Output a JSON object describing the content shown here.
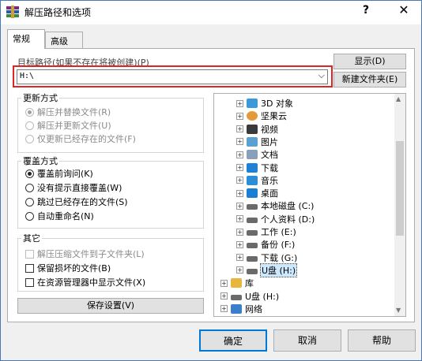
{
  "window": {
    "title": "解压路径和选项",
    "help": "?",
    "close": "✕"
  },
  "tabs": [
    {
      "label": "常规"
    },
    {
      "label": "高级"
    }
  ],
  "destination": {
    "label": "目标路径(如果不存在将被创建)(P)",
    "value": "H:\\",
    "show_button": "显示(D)",
    "new_folder_button": "新建文件夹(E)"
  },
  "update_mode": {
    "title": "更新方式",
    "options": [
      {
        "label": "解压并替换文件(R)",
        "checked": true,
        "disabled": true
      },
      {
        "label": "解压并更新文件(U)",
        "checked": false,
        "disabled": true
      },
      {
        "label": "仅更新已经存在的文件(F)",
        "checked": false,
        "disabled": true
      }
    ]
  },
  "overwrite_mode": {
    "title": "覆盖方式",
    "options": [
      {
        "label": "覆盖前询问(K)",
        "checked": true
      },
      {
        "label": "没有提示直接覆盖(W)",
        "checked": false
      },
      {
        "label": "跳过已经存在的文件(S)",
        "checked": false
      },
      {
        "label": "自动重命名(N)",
        "checked": false
      }
    ]
  },
  "misc": {
    "title": "其它",
    "options": [
      {
        "label": "解压压缩文件到子文件夹(L)",
        "checked": false,
        "disabled": true
      },
      {
        "label": "保留损坏的文件(B)",
        "checked": false,
        "disabled": false
      },
      {
        "label": "在资源管理器中显示文件(X)",
        "checked": false,
        "disabled": false
      }
    ]
  },
  "save_button": "保存设置(V)",
  "tree": [
    {
      "label": "3D 对象",
      "icon": "3d-objects-icon",
      "color": "#3a9ad9"
    },
    {
      "label": "坚果云",
      "icon": "nutstore-icon",
      "color": "#e39b3a"
    },
    {
      "label": "视频",
      "icon": "video-icon",
      "color": "#3a3a3a"
    },
    {
      "label": "图片",
      "icon": "pictures-icon",
      "color": "#5aa0d0"
    },
    {
      "label": "文档",
      "icon": "documents-icon",
      "color": "#8aa0b8"
    },
    {
      "label": "下载",
      "icon": "downloads-icon",
      "color": "#1e80d6"
    },
    {
      "label": "音乐",
      "icon": "music-icon",
      "color": "#2a8fd8"
    },
    {
      "label": "桌面",
      "icon": "desktop-icon",
      "color": "#1a7fd4"
    },
    {
      "label": "本地磁盘 (C:)",
      "icon": "drive-icon",
      "color": "#6a6a6a"
    },
    {
      "label": "个人资料 (D:)",
      "icon": "drive-icon",
      "color": "#6a6a6a"
    },
    {
      "label": "工作 (E:)",
      "icon": "drive-icon",
      "color": "#6a6a6a"
    },
    {
      "label": "备份 (F:)",
      "icon": "drive-icon",
      "color": "#6a6a6a"
    },
    {
      "label": "下载 (G:)",
      "icon": "drive-icon",
      "color": "#6a6a6a"
    },
    {
      "label": "U盘 (H:)",
      "icon": "usb-drive-icon",
      "color": "#6a6a6a",
      "selected": true
    },
    {
      "label": "库",
      "icon": "library-icon",
      "color": "#e7b63c",
      "top": true
    },
    {
      "label": "U盘 (H:)",
      "icon": "usb-drive-icon",
      "color": "#6a6a6a",
      "top": true
    },
    {
      "label": "网络",
      "icon": "network-icon",
      "color": "#3c7fc9",
      "top": true
    }
  ],
  "footer": {
    "ok": "确定",
    "cancel": "取消",
    "help": "帮助"
  }
}
